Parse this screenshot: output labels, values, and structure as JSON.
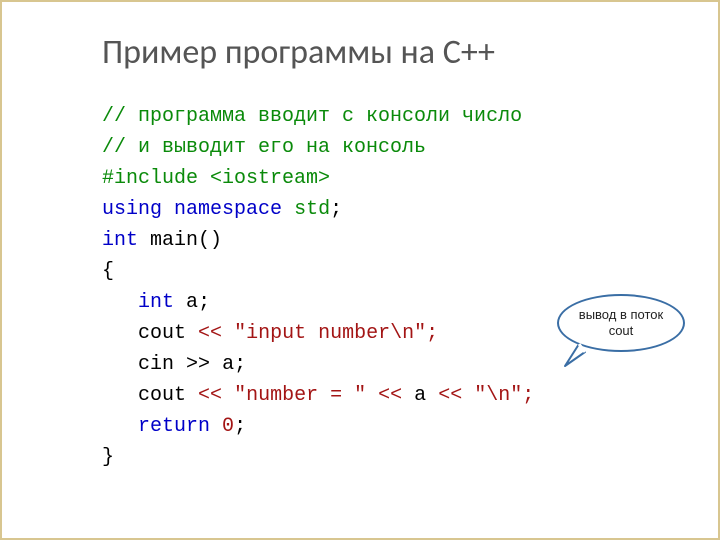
{
  "title": "Пример программы на С++",
  "callout": {
    "line1": "вывод в поток",
    "line2": "cout"
  },
  "code": {
    "comment1": "// программа вводит с консоли число",
    "comment2": "// и выводит его на консоль",
    "include_kw": "#include",
    "include_hdr": "<iostream>",
    "using_kw": "using",
    "namespace_kw": "namespace",
    "std_name": "std",
    "int_kw": "int",
    "main_name": "main()",
    "lbrace": "{",
    "var_decl_kw": "int",
    "var_name": "a",
    "cout": "cout",
    "lt2": "<<",
    "str_input": "\"input number\\n\"",
    "cin": "cin",
    "gt2": ">>",
    "str_numeq": "\"number = \"",
    "a": "a",
    "str_nl": "\"\\n\"",
    "return_kw": "return",
    "zero": "0",
    "rbrace": "}",
    "semi": ";"
  }
}
